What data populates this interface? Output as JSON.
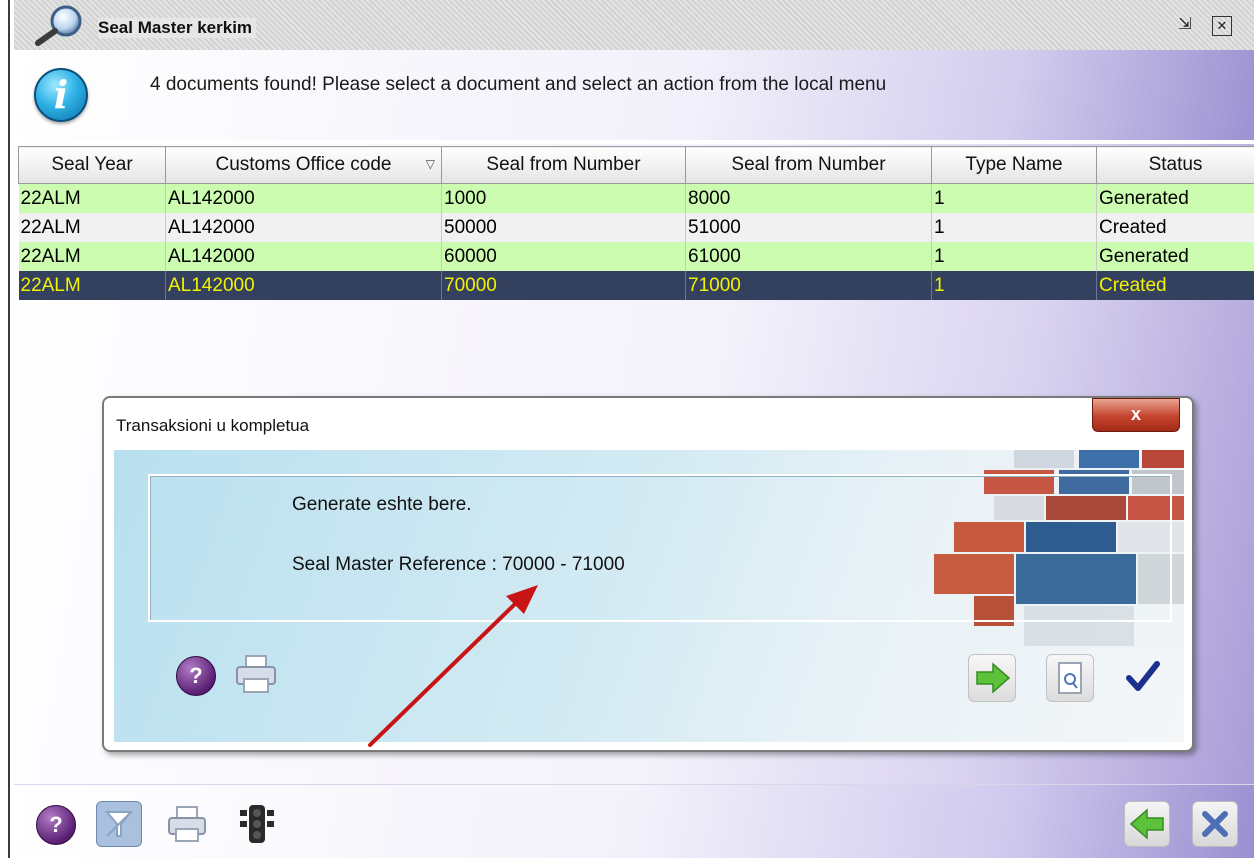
{
  "window": {
    "title": "Seal Master kerkim",
    "info_message": "4 documents found! Please select a document and select an action from the local menu"
  },
  "table": {
    "columns": [
      "Seal Year",
      "Customs Office code",
      "Seal from Number",
      "Seal from Number",
      "Type Name",
      "Status"
    ],
    "rows": [
      [
        "22ALM",
        "AL142000",
        "1000",
        "8000",
        "1",
        "Generated"
      ],
      [
        "22ALM",
        "AL142000",
        "50000",
        "51000",
        "1",
        "Created"
      ],
      [
        "22ALM",
        "AL142000",
        "60000",
        "61000",
        "1",
        "Generated"
      ],
      [
        "22ALM",
        "AL142000",
        "70000",
        "71000",
        "1",
        "Created"
      ]
    ],
    "selected_row": 3,
    "sorted_column": "Customs Office code"
  },
  "dialog": {
    "title": "Transaksioni  u kompletua",
    "close_label": "x",
    "message_line1": "Generate eshte bere.",
    "message_line2": "Seal Master Reference : 70000 - 71000",
    "help_label": "?"
  },
  "toolbar": {
    "help_label": "?"
  },
  "colors": {
    "row_green": "#ccfcb0",
    "row_white": "#f1f1f1",
    "row_selected_bg": "#33415f",
    "row_selected_text": "#f3f200",
    "annotation_arrow": "#c81414"
  },
  "icons": [
    "search-icon",
    "restore-icon",
    "close-window-icon",
    "info-icon",
    "help-icon",
    "print-icon",
    "next-arrow-icon",
    "preview-icon",
    "checkmark-icon",
    "filter-icon",
    "traffic-light-icon",
    "back-arrow-icon",
    "cancel-x-icon"
  ]
}
